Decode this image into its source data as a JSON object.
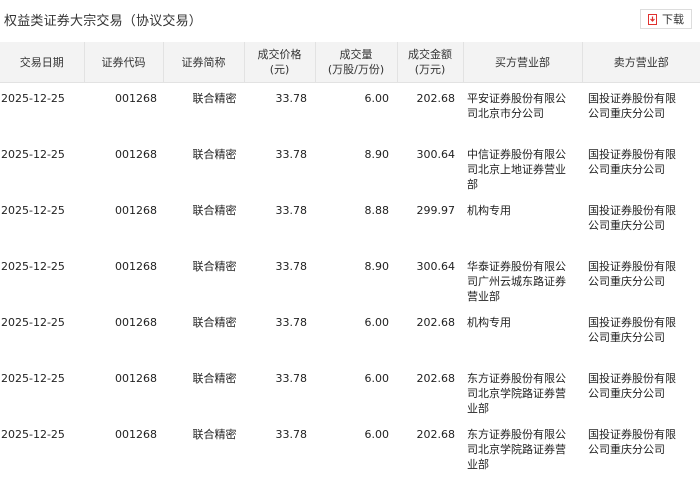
{
  "page": {
    "title": "权益类证券大宗交易（协议交易）"
  },
  "toolbar": {
    "download_label": "下载"
  },
  "table": {
    "headers": [
      "交易日期",
      "证券代码",
      "证券简称",
      "成交价格\n(元)",
      "成交量\n(万股/万份)",
      "成交金额\n(万元)",
      "买方营业部",
      "卖方营业部"
    ],
    "rows": [
      [
        "2025-12-25",
        "001268",
        "联合精密",
        "33.78",
        "6.00",
        "202.68",
        "平安证券股份有限公司北京市分公司",
        "国投证券股份有限公司重庆分公司"
      ],
      [
        "2025-12-25",
        "001268",
        "联合精密",
        "33.78",
        "8.90",
        "300.64",
        "中信证券股份有限公司北京上地证券营业部",
        "国投证券股份有限公司重庆分公司"
      ],
      [
        "2025-12-25",
        "001268",
        "联合精密",
        "33.78",
        "8.88",
        "299.97",
        "机构专用",
        "国投证券股份有限公司重庆分公司"
      ],
      [
        "2025-12-25",
        "001268",
        "联合精密",
        "33.78",
        "8.90",
        "300.64",
        "华泰证券股份有限公司广州云城东路证券营业部",
        "国投证券股份有限公司重庆分公司"
      ],
      [
        "2025-12-25",
        "001268",
        "联合精密",
        "33.78",
        "6.00",
        "202.68",
        "机构专用",
        "国投证券股份有限公司重庆分公司"
      ],
      [
        "2025-12-25",
        "001268",
        "联合精密",
        "33.78",
        "6.00",
        "202.68",
        "东方证券股份有限公司北京学院路证券营业部",
        "国投证券股份有限公司重庆分公司"
      ],
      [
        "2025-12-25",
        "001268",
        "联合精密",
        "33.78",
        "6.00",
        "202.68",
        "东方证券股份有限公司北京学院路证券营业部",
        "国投证券股份有限公司重庆分公司"
      ]
    ]
  },
  "colors": {
    "accent": "#e0312f",
    "header_bg": "#f3f3f3",
    "border": "#e2e2e2"
  },
  "icons": {
    "download": "download-icon"
  }
}
